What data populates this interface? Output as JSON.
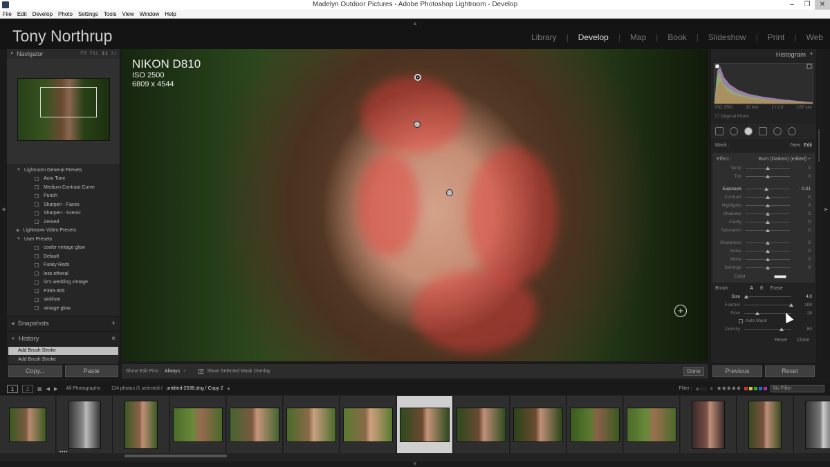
{
  "window": {
    "title": "Madelyn Outdoor Pictures - Adobe Photoshop Lightroom - Develop",
    "minimize": "‒",
    "maximize": "❐",
    "close": "✕"
  },
  "menu": [
    "File",
    "Edit",
    "Develop",
    "Photo",
    "Settings",
    "Tools",
    "View",
    "Window",
    "Help"
  ],
  "identity_plate": "Tony Northrup",
  "modules": [
    "Library",
    "Develop",
    "Map",
    "Book",
    "Slideshow",
    "Print",
    "Web"
  ],
  "active_module": "Develop",
  "navigator": {
    "title": "Navigator",
    "zoom": [
      "FIT",
      "FILL",
      "1:1",
      "3:1"
    ],
    "selected_zoom": "1:1"
  },
  "presets": {
    "folders": [
      {
        "name": "Lightroom General Presets",
        "items": [
          "Auto Tone",
          "Medium Contrast Curve",
          "Punch",
          "Sharpen - Faces",
          "Sharpen - Scenic",
          "Zeroed"
        ]
      },
      {
        "name": "Lightroom Video Presets",
        "items": []
      },
      {
        "name": "User Presets",
        "items": [
          "cooler vintage glow",
          "Default",
          "Funky Reds",
          "less etheral",
          "liz's wedding vintage",
          "P365-365",
          "siobhan",
          "vintage glow"
        ]
      }
    ]
  },
  "snapshots": {
    "title": "Snapshots",
    "add": "+"
  },
  "history": {
    "title": "History",
    "clear": "×",
    "items": [
      "Add Brush Stroke",
      "Add Brush Stroke"
    ]
  },
  "left_buttons": {
    "copy": "Copy...",
    "paste": "Paste"
  },
  "photo_info": {
    "camera": "NIKON D810",
    "iso": "ISO 2500",
    "dimensions": "6809 x 4544"
  },
  "toolbar": {
    "edit_pins_label": "Show Edit Pins :",
    "edit_pins_value": "Always",
    "mask_overlay": "Show Selected Mask Overlay",
    "done": "Done"
  },
  "histogram": {
    "title": "Histogram",
    "iso": "ISO 2500",
    "focal": "32 mm",
    "aperture": "ƒ / 2.8",
    "shutter": "1/50 sec",
    "original": "Original Photo"
  },
  "mask": {
    "label": "Mask :",
    "new": "New",
    "edit": "Edit"
  },
  "effect": {
    "label": "Effect :",
    "value": "Burn (Darken) (edited) ÷"
  },
  "sliders_a": [
    {
      "label": "Temp",
      "value": "0",
      "pos": 0.5
    },
    {
      "label": "Tint",
      "value": "0",
      "pos": 0.5
    }
  ],
  "sliders_b": [
    {
      "label": "Exposure",
      "value": "- 0.21",
      "pos": 0.47,
      "hi": true
    },
    {
      "label": "Contrast",
      "value": "0",
      "pos": 0.5
    },
    {
      "label": "Highlights",
      "value": "0",
      "pos": 0.5
    },
    {
      "label": "Shadows",
      "value": "0",
      "pos": 0.5
    },
    {
      "label": "Clarity",
      "value": "0",
      "pos": 0.5
    },
    {
      "label": "Saturation",
      "value": "0",
      "pos": 0.5
    }
  ],
  "sliders_c": [
    {
      "label": "Sharpness",
      "value": "0",
      "pos": 0.5
    },
    {
      "label": "Noise",
      "value": "0",
      "pos": 0.5
    },
    {
      "label": "Moire",
      "value": "0",
      "pos": 0.5
    },
    {
      "label": "Defringe",
      "value": "0",
      "pos": 0.5
    }
  ],
  "color_label": "Color",
  "brush": {
    "label": "Brush :",
    "a": "A",
    "b": "B",
    "erase": "Erase"
  },
  "brush_sliders": [
    {
      "label": "Size",
      "value": "4.0",
      "pos": 0.05,
      "hi": true
    },
    {
      "label": "Feather",
      "value": "100",
      "pos": 1.0
    },
    {
      "label": "Flow",
      "value": "28",
      "pos": 0.28
    }
  ],
  "auto_mask": "Auto Mask",
  "density": {
    "label": "Density",
    "value": "80",
    "pos": 0.8
  },
  "panel_bottom": {
    "reset": "Reset",
    "close": "Close"
  },
  "right_buttons": {
    "previous": "Previous",
    "reset": "Reset"
  },
  "filmstrip_bar": {
    "page1": "1",
    "page2": "2",
    "source": "All Photographs",
    "count": "114 photos /1 selected /",
    "path": "untitled-2538.dng / Copy 2",
    "filter_label": "Filter :",
    "no_filter": "No Filter"
  },
  "colors": {
    "mask": "#e63c3c",
    "accent": "#dddddd",
    "panel": "#222222"
  }
}
